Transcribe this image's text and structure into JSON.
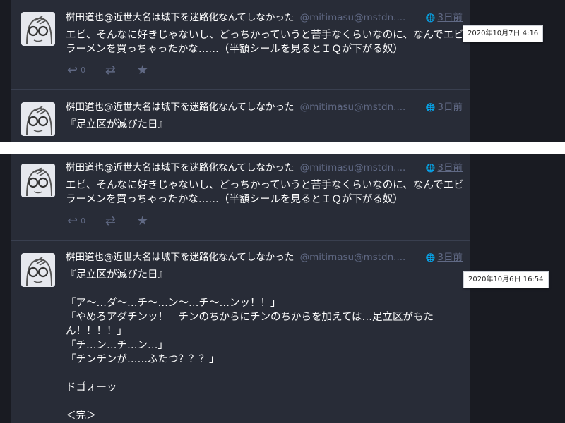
{
  "top_panel": {
    "status1": {
      "display_name": "桝田道也@近世大名は城下を迷路化なんてしなかった",
      "account": "@mitimasu@mstdn....",
      "relative_time": "3日前",
      "content": [
        "エビ、そんなに好きじゃないし、どっちかっていうと苦手なくらいなのに、なんでエビラーメンを買っちゃったかな……（半額シールを見るとＩＱが下がる奴）"
      ],
      "reply_count": "0"
    },
    "status2": {
      "display_name": "桝田道也@近世大名は城下を迷路化なんてしなかった",
      "account": "@mitimasu@mstdn....",
      "relative_time": "3日前",
      "content": [
        "『足立区が滅びた日』"
      ]
    },
    "tooltip": "2020年10月7日 4:16"
  },
  "bottom_panel": {
    "status1": {
      "display_name": "桝田道也@近世大名は城下を迷路化なんてしなかった",
      "account": "@mitimasu@mstdn....",
      "relative_time": "3日前",
      "content": [
        "エビ、そんなに好きじゃないし、どっちかっていうと苦手なくらいなのに、なんでエビラーメンを買っちゃったかな……（半額シールを見るとＩＱが下がる奴）"
      ],
      "reply_count": "0"
    },
    "status2": {
      "display_name": "桝田道也@近世大名は城下を迷路化なんてしなかった",
      "account": "@mitimasu@mstdn....",
      "relative_time": "3日前",
      "content": [
        "『足立区が滅びた日』",
        "",
        "「ア～…ダ～…チ～…ン～…チ～…ンッ！！」",
        "「やめろアダチンッ！　チンのちからにチンのちからを加えては…足立区がもたん！！！！」",
        "「チ…ン…チ…ン…」",
        "「チンチンが……ふたつ？？？」",
        "",
        "ドゴォーッ",
        "",
        "＜完＞"
      ]
    },
    "tooltip": "2020年10月6日 16:54"
  },
  "icons": {
    "reply": "reply-icon",
    "boost": "boost-icon",
    "favourite": "star-icon",
    "globe": "globe-icon"
  },
  "colors": {
    "background": "#191b22",
    "column": "#282c37",
    "muted": "#606984",
    "text": "#ffffff",
    "divider": "#ffffff"
  }
}
